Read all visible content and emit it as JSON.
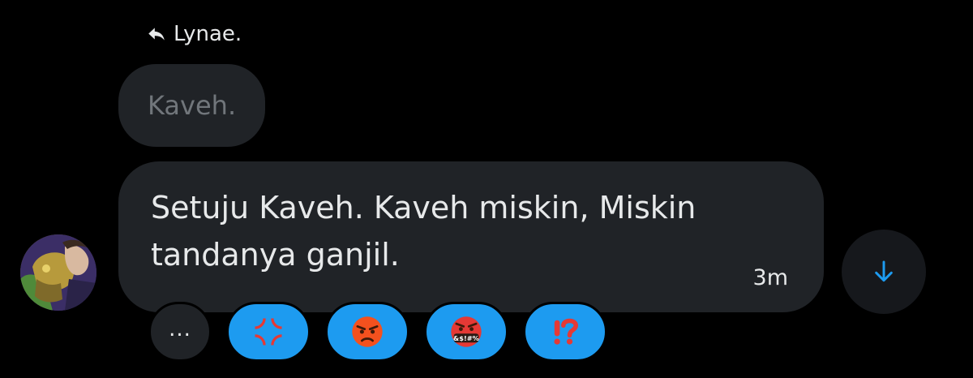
{
  "reply": {
    "author": "Lynae."
  },
  "quoted": {
    "text": "Kaveh."
  },
  "message": {
    "line1": "Setuju Kaveh. Kaveh miskin, Miskin",
    "line2": "tandanya ganjil.",
    "time": "3m"
  },
  "reactions": {
    "more_label": "...",
    "items": [
      {
        "name": "anger-symbol",
        "emoji": "💢"
      },
      {
        "name": "pouting-face",
        "emoji": "😡"
      },
      {
        "name": "face-with-symbols-on-mouth",
        "emoji": "🤬",
        "symbols_text": "&$!#%"
      },
      {
        "name": "exclamation-question-mark",
        "emoji": "⁉️"
      }
    ]
  },
  "colors": {
    "background": "#000000",
    "bubble": "#202327",
    "text": "#e7e9ea",
    "muted_text": "#71767b",
    "accent": "#1d9bf0"
  },
  "icons": {
    "reply": "reply-arrow-icon",
    "scroll_down": "arrow-down-icon"
  }
}
